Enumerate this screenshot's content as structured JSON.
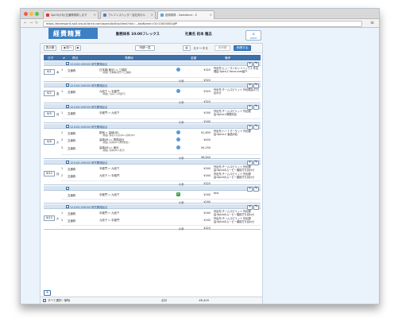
{
  "browser": {
    "tabs": [
      {
        "label": "Spirit(かな)交通費精算します"
      },
      {
        "label": "プレゾンスヘッダー会社向けル"
      },
      {
        "label": "経費精算 - Salesforce - E"
      }
    ],
    "url": "https://teamspirit.ap0.visual.force.com/apex/AtkExpView?vId=...tabName=01r10000000JjfP"
  },
  "header": {
    "logo": "経費精算",
    "work_system": "勤務体系 10:00フレックス",
    "employee": "社員名 松本 隆志",
    "icon_label": "SPIRIT"
  },
  "toolbar": {
    "period": "表示期",
    "prev_month": "◀ 前へ",
    "next_month": "▶",
    "list_button": "申請一覧",
    "status_label": "ステータス",
    "status_value": "未申請",
    "apply_button": "申請する"
  },
  "table_header": {
    "date": "日付",
    "no": "#",
    "kind": "費目",
    "route": "発着地",
    "amount": "金額",
    "note": "備考"
  },
  "groups": [
    {
      "date": "8/1",
      "wday": "木",
      "title": "121001159005 研究開発起点",
      "rows": [
        {
          "no": "1",
          "kind": "交通費",
          "route": "日本橋(東京) ⇔ 三越前",
          "route2": "(経由: 日本橋(東京)→三越前)",
          "amount": "¥320",
          "note": "外出先:ヒューマンセントリックス 外出理由:Spiro-C force.com紹介"
        }
      ],
      "subtotal_label": "小計",
      "subtotal": "¥320"
    },
    {
      "date": "8/2",
      "wday": "金",
      "title": "121001159005 研究開発起点",
      "rows": [
        {
          "no": "1",
          "kind": "交通費",
          "route": "九段下 ⇔ 半蔵門",
          "route2": "(経由: 九段下→半蔵門)",
          "amount": "¥320",
          "note": "外出先:チームスピリット 外出理由:打ち合わせ"
        }
      ],
      "subtotal_label": "小計",
      "subtotal": "¥320"
    },
    {
      "date": "8/5",
      "wday": "月",
      "title": "121001159005 研究開発起点",
      "rows": [
        {
          "no": "1",
          "kind": "交通費",
          "route": "半蔵門 ⇔ 九段下",
          "route2": "",
          "amount": "¥160",
          "note": "外出先:チームスピリット 外出理由:Spice-C開発対応"
        }
      ],
      "subtotal_label": "小計",
      "subtotal": "¥160"
    },
    {
      "date": "8/6",
      "wday": "火",
      "title": "121001159005 研究開発起点",
      "rows": [
        {
          "no": "1",
          "kind": "交通費",
          "route": "新宿 ⇔ 高崎(JR)",
          "route2": "(経由: 新宿→大宮(JR)→高崎(JR))",
          "amount": "¥1,800",
          "note": "外出先:ハートマーケット 外出理由:Spice-C 製品対応"
        },
        {
          "no": "2",
          "kind": "交通費",
          "route": "高崎(JR) ⇔ 群馬総社",
          "route2": "(経由: 高崎(JR)→群馬総社)",
          "amount": "¥400",
          "note": ""
        },
        {
          "no": "3",
          "kind": "交通費",
          "route": "高崎(JR) ⇔ 東京",
          "route2": "(経由: 高崎(JR)→東京)",
          "amount": "¥4,290",
          "note": ""
        }
      ],
      "subtotal_label": "小計",
      "subtotal": "¥6,640"
    },
    {
      "date": "8/12",
      "wday": "月",
      "title": "121001159005 研究開発起点",
      "rows": [
        {
          "no": "1",
          "kind": "交通費",
          "route": "半蔵門 ⇔ 九段下",
          "route2": "",
          "amount": "¥160",
          "note": "外出先:チームスピリット 外出理由:Spiceのムービー撮影打ち合わせ"
        },
        {
          "no": "2",
          "kind": "交通費",
          "route": "九段下 ⇔ 半蔵門",
          "route2": "",
          "amount": "¥160",
          "note": "外出先:チームスピリット 外出理由:Spiceのムービー撮影打ち合わせ"
        }
      ],
      "subtotal_label": "小計",
      "subtotal": "¥320"
    },
    {
      "date": "",
      "wday": "",
      "title": "",
      "rows": [
        {
          "no": "",
          "kind": "交通費",
          "route": "半蔵門 ⇔ 九段下",
          "route2": "",
          "amount": "¥160",
          "note": "test",
          "ic": "IC"
        }
      ],
      "subtotal_label": "小計",
      "subtotal": "¥160"
    },
    {
      "date": "8/13",
      "wday": "火",
      "title": "121001159005 研究開発起点",
      "rows": [
        {
          "no": "1",
          "kind": "交通費",
          "route": "半蔵門 ⇔ 九段下",
          "route2": "",
          "amount": "¥160",
          "note": "外出先:チームスピリット 外出理由:Spiceのムービー撮影打ち合わせ"
        },
        {
          "no": "2",
          "kind": "交通費",
          "route": "九段下 ⇔ 半蔵門",
          "route2": "",
          "amount": "¥160",
          "note": "外出先:チームスピリット 外出理由:Spiceのムービー撮影打ち合わせ"
        }
      ],
      "subtotal_label": "小計",
      "subtotal": "¥320"
    }
  ],
  "footer": {
    "select_all": "すべて選択／解除",
    "total_label": "合計",
    "total": "¥8,400"
  }
}
